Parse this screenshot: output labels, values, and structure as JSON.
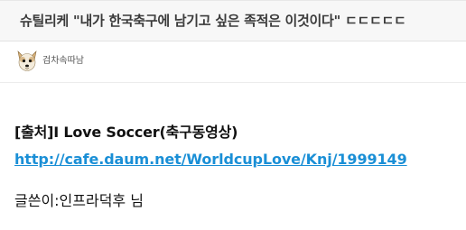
{
  "post": {
    "title": "슈틸리케 \"내가 한국축구에 남기고 싶은 족적은 이것이다\" ㄷㄷㄷㄷㄷ",
    "author": "검차속따남"
  },
  "body": {
    "source_label": "[출처]I Love Soccer(축구동영상)",
    "source_url": "http://cafe.daum.net/WorldcupLove/Knj/1999149",
    "credit": "글쓴이:인프라덕후 님"
  }
}
